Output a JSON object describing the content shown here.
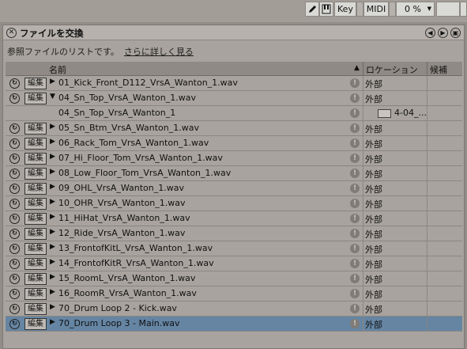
{
  "toolbar": {
    "key_label": "Key",
    "midi_label": "MIDI",
    "percent_value": "0 %",
    "pencil_icon": "pencil-icon",
    "keyboard_icon": "keyboard-icon"
  },
  "panel": {
    "title": "ファイルを交換",
    "subtitle": "参照ファイルのリストです。",
    "link": "さらに詳しく見る"
  },
  "table": {
    "headers": {
      "name": "名前",
      "sort_indicator": "▲",
      "location": "ロケーション",
      "candidates": "候補"
    },
    "edit_label": "編集",
    "rows": [
      {
        "name": "01_Kick_Front_D112_VrsA_Wanton_1.wav",
        "location": "外部",
        "expand": "▶",
        "selected": false,
        "child": false
      },
      {
        "name": "04_Sn_Top_VrsA_Wanton_1.wav",
        "location": "外部",
        "expand": "▼",
        "selected": false,
        "child": false
      },
      {
        "name": "04_Sn_Top_VrsA_Wanton_1",
        "location": "4-04_...",
        "expand": "",
        "selected": false,
        "child": true
      },
      {
        "name": "05_Sn_Btm_VrsA_Wanton_1.wav",
        "location": "外部",
        "expand": "▶",
        "selected": false,
        "child": false
      },
      {
        "name": "06_Rack_Tom_VrsA_Wanton_1.wav",
        "location": "外部",
        "expand": "▶",
        "selected": false,
        "child": false
      },
      {
        "name": "07_Hi_Floor_Tom_VrsA_Wanton_1.wav",
        "location": "外部",
        "expand": "▶",
        "selected": false,
        "child": false
      },
      {
        "name": "08_Low_Floor_Tom_VrsA_Wanton_1.wav",
        "location": "外部",
        "expand": "▶",
        "selected": false,
        "child": false
      },
      {
        "name": "09_OHL_VrsA_Wanton_1.wav",
        "location": "外部",
        "expand": "▶",
        "selected": false,
        "child": false
      },
      {
        "name": "10_OHR_VrsA_Wanton_1.wav",
        "location": "外部",
        "expand": "▶",
        "selected": false,
        "child": false
      },
      {
        "name": "11_HiHat_VrsA_Wanton_1.wav",
        "location": "外部",
        "expand": "▶",
        "selected": false,
        "child": false
      },
      {
        "name": "12_Ride_VrsA_Wanton_1.wav",
        "location": "外部",
        "expand": "▶",
        "selected": false,
        "child": false
      },
      {
        "name": "13_FrontofKitL_VrsA_Wanton_1.wav",
        "location": "外部",
        "expand": "▶",
        "selected": false,
        "child": false
      },
      {
        "name": "14_FrontofKitR_VrsA_Wanton_1.wav",
        "location": "外部",
        "expand": "▶",
        "selected": false,
        "child": false
      },
      {
        "name": "15_RoomL_VrsA_Wanton_1.wav",
        "location": "外部",
        "expand": "▶",
        "selected": false,
        "child": false
      },
      {
        "name": "16_RoomR_VrsA_Wanton_1.wav",
        "location": "外部",
        "expand": "▶",
        "selected": false,
        "child": false
      },
      {
        "name": "70_Drum Loop 2 - Kick.wav",
        "location": "外部",
        "expand": "▶",
        "selected": false,
        "child": false
      },
      {
        "name": "70_Drum Loop 3 - Main.wav",
        "location": "外部",
        "expand": "▶",
        "selected": true,
        "child": false
      }
    ]
  },
  "colors": {
    "selected_row": "#6585a3",
    "panel_bg": "#a8a39e"
  }
}
